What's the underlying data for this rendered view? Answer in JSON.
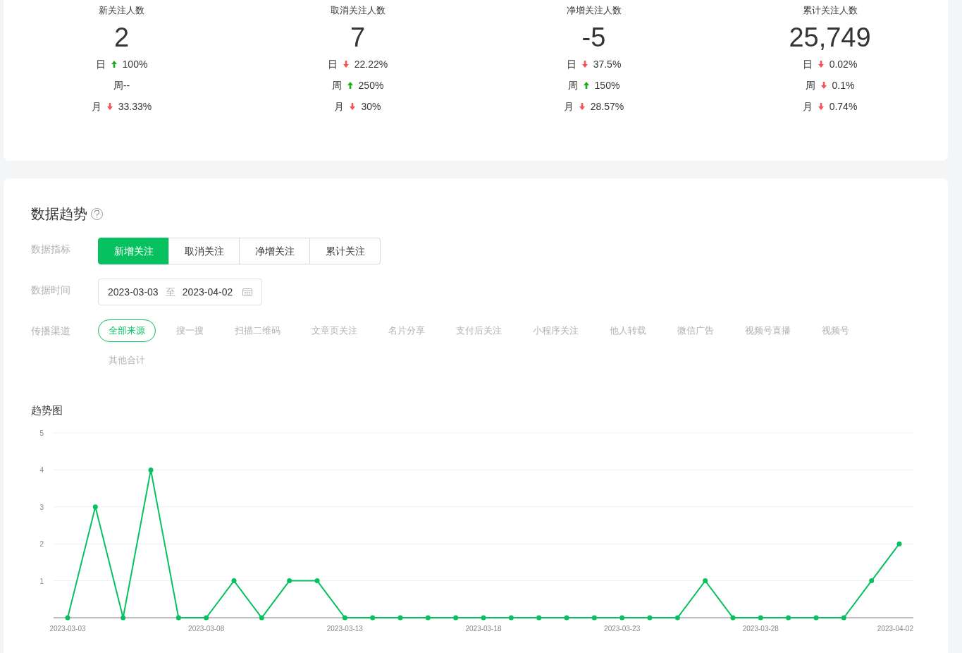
{
  "stats": [
    {
      "title": "新关注人数",
      "value": "2",
      "changes": [
        {
          "period": "日",
          "increase": true,
          "percent": "100%"
        },
        {
          "period": "周--"
        },
        {
          "period": "月",
          "increase": false,
          "percent": "33.33%"
        }
      ]
    },
    {
      "title": "取消关注人数",
      "value": "7",
      "changes": [
        {
          "period": "日",
          "increase": false,
          "percent": "22.22%"
        },
        {
          "period": "周",
          "increase": true,
          "percent": "250%"
        },
        {
          "period": "月",
          "increase": false,
          "percent": "30%"
        }
      ]
    },
    {
      "title": "净增关注人数",
      "value": "-5",
      "changes": [
        {
          "period": "日",
          "increase": false,
          "percent": "37.5%"
        },
        {
          "period": "周",
          "increase": true,
          "percent": "150%"
        },
        {
          "period": "月",
          "increase": false,
          "percent": "28.57%"
        }
      ]
    },
    {
      "title": "累计关注人数",
      "value": "25,749",
      "changes": [
        {
          "period": "日",
          "increase": false,
          "percent": "0.02%"
        },
        {
          "period": "周",
          "increase": false,
          "percent": "0.1%"
        },
        {
          "period": "月",
          "increase": false,
          "percent": "0.74%"
        }
      ]
    }
  ],
  "trend": {
    "title": "数据趋势",
    "metric_label": "数据指标",
    "metrics": [
      {
        "label": "新增关注",
        "selected": true
      },
      {
        "label": "取消关注",
        "selected": false
      },
      {
        "label": "净增关注",
        "selected": false
      },
      {
        "label": "累计关注",
        "selected": false
      }
    ],
    "time_label": "数据时间",
    "date_range": {
      "start": "2023-03-03",
      "separator": "至",
      "end": "2023-04-02"
    },
    "channel_label": "传播渠道",
    "channels": [
      {
        "label": "全部来源",
        "selected": true
      },
      {
        "label": "搜一搜",
        "selected": false
      },
      {
        "label": "扫描二维码",
        "selected": false
      },
      {
        "label": "文章页关注",
        "selected": false
      },
      {
        "label": "名片分享",
        "selected": false
      },
      {
        "label": "支付后关注",
        "selected": false
      },
      {
        "label": "小程序关注",
        "selected": false
      },
      {
        "label": "他人转载",
        "selected": false
      },
      {
        "label": "微信广告",
        "selected": false
      },
      {
        "label": "视频号直播",
        "selected": false
      },
      {
        "label": "视频号",
        "selected": false
      },
      {
        "label": "其他合计",
        "selected": false
      }
    ],
    "chart_title": "趋势图",
    "chart_data": {
      "type": "line",
      "categories": [
        "2023-03-03",
        null,
        null,
        null,
        null,
        "2023-03-08",
        null,
        null,
        null,
        null,
        "2023-03-13",
        null,
        null,
        null,
        null,
        "2023-03-18",
        null,
        null,
        null,
        null,
        "2023-03-23",
        null,
        null,
        null,
        null,
        "2023-03-28",
        null,
        null,
        null,
        null,
        "2023-04-02"
      ],
      "grid": true,
      "series": [
        {
          "color": "#07c160",
          "marker": true,
          "values": [
            0,
            3,
            0,
            4,
            0,
            0,
            1,
            0,
            1,
            1,
            0,
            0,
            0,
            0,
            0,
            0,
            0,
            0,
            0,
            0,
            0,
            0,
            0,
            1,
            0,
            0,
            0,
            0,
            0,
            1,
            2
          ]
        }
      ],
      "ylim": [
        0,
        5
      ],
      "yticks": [
        1,
        2,
        3,
        4,
        5
      ]
    }
  }
}
